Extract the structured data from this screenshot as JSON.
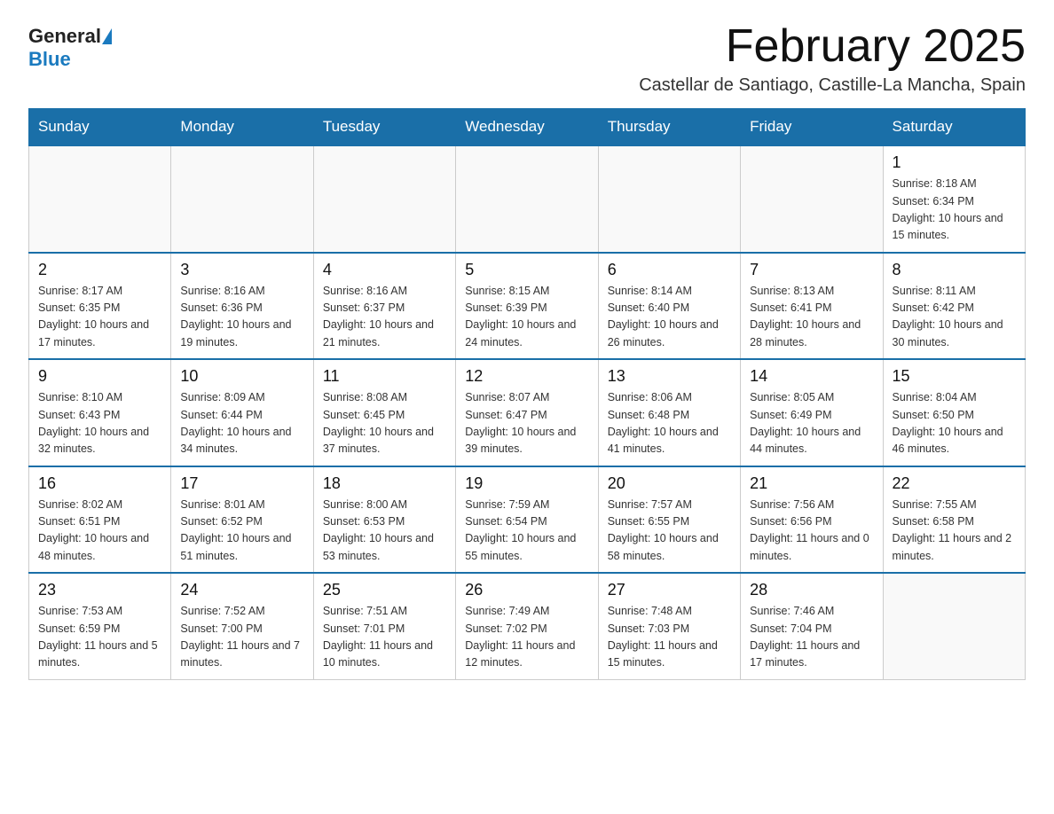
{
  "header": {
    "logo_general": "General",
    "logo_blue": "Blue",
    "month_title": "February 2025",
    "subtitle": "Castellar de Santiago, Castille-La Mancha, Spain"
  },
  "weekdays": [
    "Sunday",
    "Monday",
    "Tuesday",
    "Wednesday",
    "Thursday",
    "Friday",
    "Saturday"
  ],
  "weeks": [
    [
      {
        "day": "",
        "info": ""
      },
      {
        "day": "",
        "info": ""
      },
      {
        "day": "",
        "info": ""
      },
      {
        "day": "",
        "info": ""
      },
      {
        "day": "",
        "info": ""
      },
      {
        "day": "",
        "info": ""
      },
      {
        "day": "1",
        "info": "Sunrise: 8:18 AM\nSunset: 6:34 PM\nDaylight: 10 hours and 15 minutes."
      }
    ],
    [
      {
        "day": "2",
        "info": "Sunrise: 8:17 AM\nSunset: 6:35 PM\nDaylight: 10 hours and 17 minutes."
      },
      {
        "day": "3",
        "info": "Sunrise: 8:16 AM\nSunset: 6:36 PM\nDaylight: 10 hours and 19 minutes."
      },
      {
        "day": "4",
        "info": "Sunrise: 8:16 AM\nSunset: 6:37 PM\nDaylight: 10 hours and 21 minutes."
      },
      {
        "day": "5",
        "info": "Sunrise: 8:15 AM\nSunset: 6:39 PM\nDaylight: 10 hours and 24 minutes."
      },
      {
        "day": "6",
        "info": "Sunrise: 8:14 AM\nSunset: 6:40 PM\nDaylight: 10 hours and 26 minutes."
      },
      {
        "day": "7",
        "info": "Sunrise: 8:13 AM\nSunset: 6:41 PM\nDaylight: 10 hours and 28 minutes."
      },
      {
        "day": "8",
        "info": "Sunrise: 8:11 AM\nSunset: 6:42 PM\nDaylight: 10 hours and 30 minutes."
      }
    ],
    [
      {
        "day": "9",
        "info": "Sunrise: 8:10 AM\nSunset: 6:43 PM\nDaylight: 10 hours and 32 minutes."
      },
      {
        "day": "10",
        "info": "Sunrise: 8:09 AM\nSunset: 6:44 PM\nDaylight: 10 hours and 34 minutes."
      },
      {
        "day": "11",
        "info": "Sunrise: 8:08 AM\nSunset: 6:45 PM\nDaylight: 10 hours and 37 minutes."
      },
      {
        "day": "12",
        "info": "Sunrise: 8:07 AM\nSunset: 6:47 PM\nDaylight: 10 hours and 39 minutes."
      },
      {
        "day": "13",
        "info": "Sunrise: 8:06 AM\nSunset: 6:48 PM\nDaylight: 10 hours and 41 minutes."
      },
      {
        "day": "14",
        "info": "Sunrise: 8:05 AM\nSunset: 6:49 PM\nDaylight: 10 hours and 44 minutes."
      },
      {
        "day": "15",
        "info": "Sunrise: 8:04 AM\nSunset: 6:50 PM\nDaylight: 10 hours and 46 minutes."
      }
    ],
    [
      {
        "day": "16",
        "info": "Sunrise: 8:02 AM\nSunset: 6:51 PM\nDaylight: 10 hours and 48 minutes."
      },
      {
        "day": "17",
        "info": "Sunrise: 8:01 AM\nSunset: 6:52 PM\nDaylight: 10 hours and 51 minutes."
      },
      {
        "day": "18",
        "info": "Sunrise: 8:00 AM\nSunset: 6:53 PM\nDaylight: 10 hours and 53 minutes."
      },
      {
        "day": "19",
        "info": "Sunrise: 7:59 AM\nSunset: 6:54 PM\nDaylight: 10 hours and 55 minutes."
      },
      {
        "day": "20",
        "info": "Sunrise: 7:57 AM\nSunset: 6:55 PM\nDaylight: 10 hours and 58 minutes."
      },
      {
        "day": "21",
        "info": "Sunrise: 7:56 AM\nSunset: 6:56 PM\nDaylight: 11 hours and 0 minutes."
      },
      {
        "day": "22",
        "info": "Sunrise: 7:55 AM\nSunset: 6:58 PM\nDaylight: 11 hours and 2 minutes."
      }
    ],
    [
      {
        "day": "23",
        "info": "Sunrise: 7:53 AM\nSunset: 6:59 PM\nDaylight: 11 hours and 5 minutes."
      },
      {
        "day": "24",
        "info": "Sunrise: 7:52 AM\nSunset: 7:00 PM\nDaylight: 11 hours and 7 minutes."
      },
      {
        "day": "25",
        "info": "Sunrise: 7:51 AM\nSunset: 7:01 PM\nDaylight: 11 hours and 10 minutes."
      },
      {
        "day": "26",
        "info": "Sunrise: 7:49 AM\nSunset: 7:02 PM\nDaylight: 11 hours and 12 minutes."
      },
      {
        "day": "27",
        "info": "Sunrise: 7:48 AM\nSunset: 7:03 PM\nDaylight: 11 hours and 15 minutes."
      },
      {
        "day": "28",
        "info": "Sunrise: 7:46 AM\nSunset: 7:04 PM\nDaylight: 11 hours and 17 minutes."
      },
      {
        "day": "",
        "info": ""
      }
    ]
  ]
}
